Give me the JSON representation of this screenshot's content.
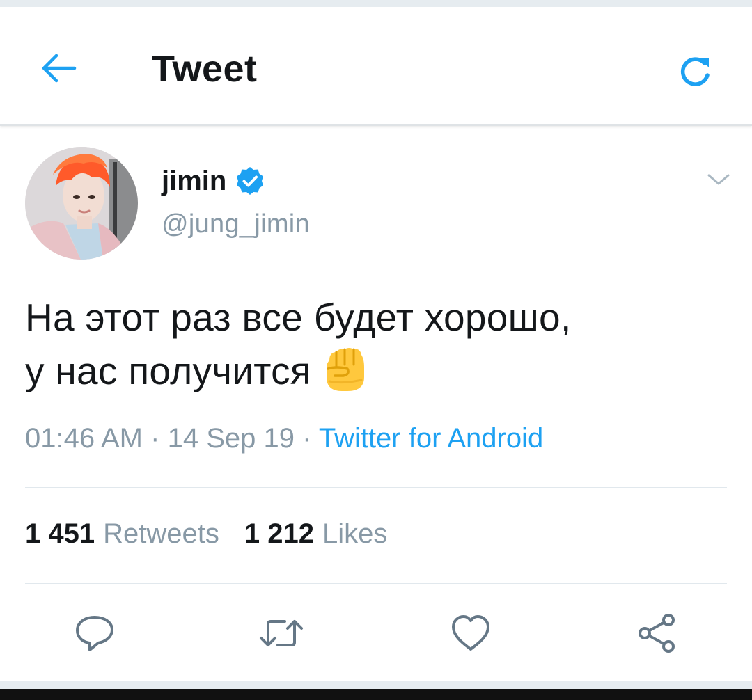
{
  "header": {
    "title": "Tweet",
    "back_icon": "arrow-left-icon",
    "refresh_icon": "refresh-icon",
    "accent_color": "#1da1f2"
  },
  "tweet": {
    "author": {
      "name": "jimin",
      "handle": "@jung_jimin",
      "verified": true
    },
    "text_line1": "На этот раз все будет хорошо,",
    "text_line2": "у нас получится",
    "emoji": "raised-fist-emoji",
    "time": "01:46 AM",
    "date": "14 Sep 19",
    "separator": "·",
    "source": "Twitter for Android",
    "stats": {
      "retweets_count": "1 451",
      "retweets_label": "Retweets",
      "likes_count": "1 212",
      "likes_label": "Likes"
    }
  },
  "actions": [
    {
      "name": "reply",
      "icon": "reply-icon"
    },
    {
      "name": "retweet",
      "icon": "retweet-icon"
    },
    {
      "name": "like",
      "icon": "heart-icon"
    },
    {
      "name": "share",
      "icon": "share-icon"
    }
  ]
}
